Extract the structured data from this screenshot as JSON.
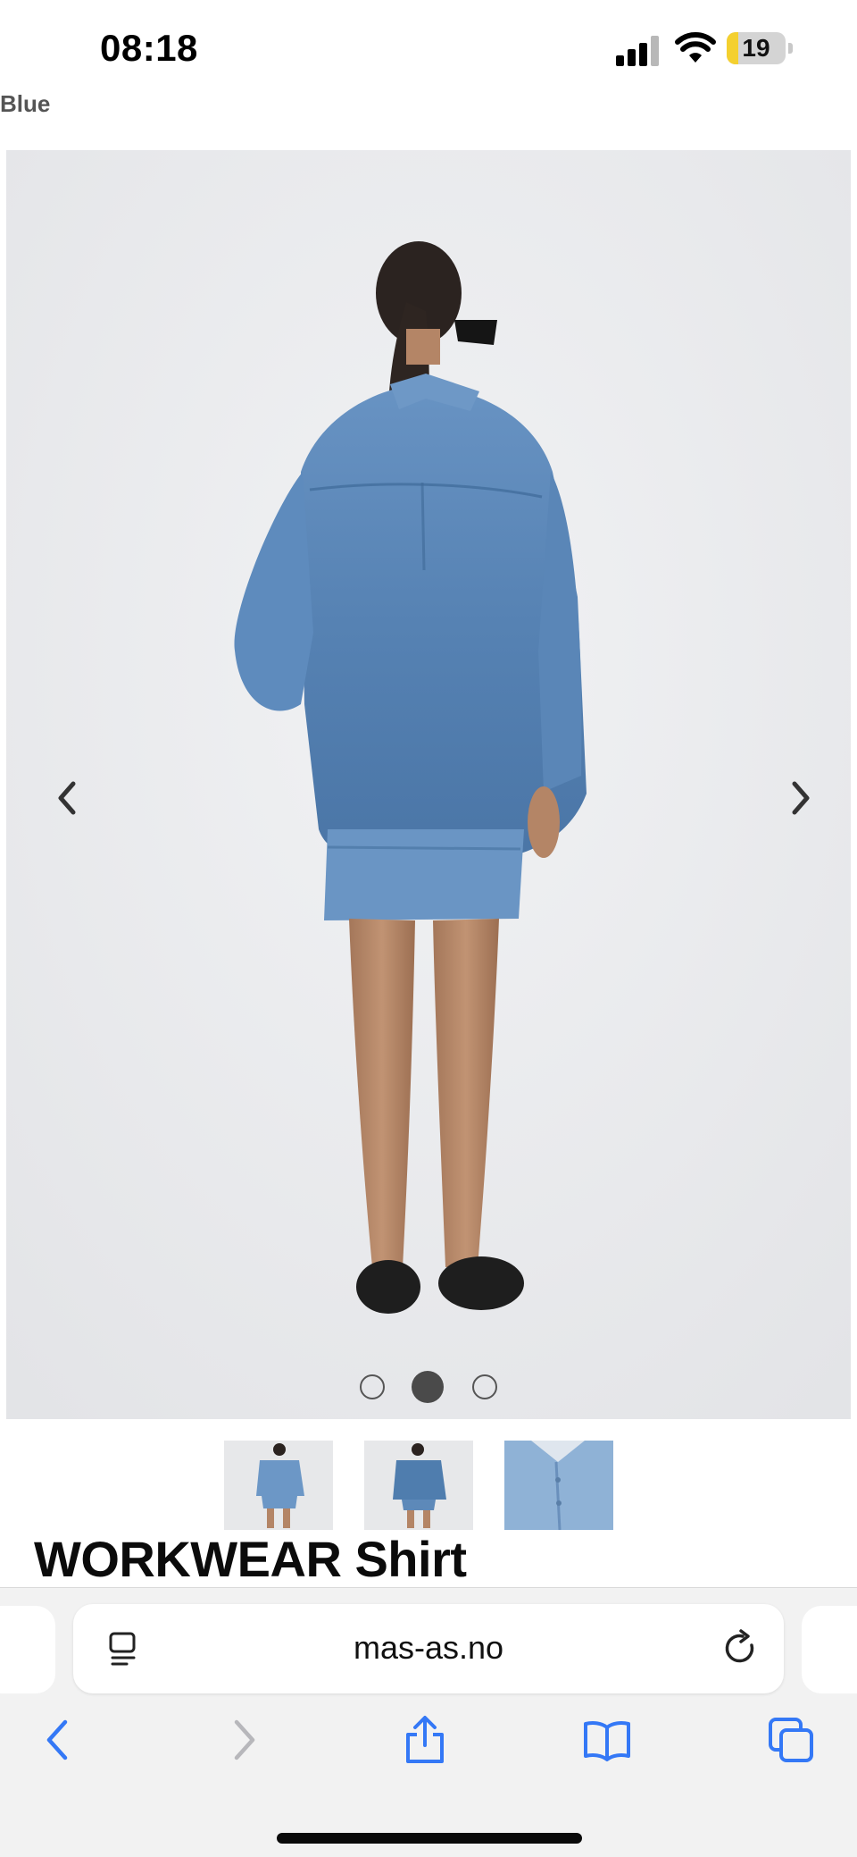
{
  "status_bar": {
    "time": "08:18",
    "battery_level": "19",
    "battery_fraction": 0.19
  },
  "product": {
    "color_label": "Blue",
    "title": "WORKWEAR Shirt"
  },
  "gallery": {
    "image_count": 3,
    "active_index": 1,
    "prev_icon": "chevron-left-icon",
    "next_icon": "chevron-right-icon",
    "thumbnails": [
      {
        "name": "thumbnail-front-view"
      },
      {
        "name": "thumbnail-back-view"
      },
      {
        "name": "thumbnail-detail-view"
      }
    ]
  },
  "browser": {
    "url": "mas-as.no",
    "page_icon": "page-menu-icon",
    "reload_icon": "reload-icon",
    "toolbar": [
      "back-icon",
      "forward-icon",
      "share-icon",
      "bookmarks-icon",
      "tabs-icon"
    ]
  },
  "colors": {
    "accent": "#3478f6",
    "denim": "#5b88b8",
    "background": "#e9eaec",
    "battery": "#f4d02f"
  }
}
